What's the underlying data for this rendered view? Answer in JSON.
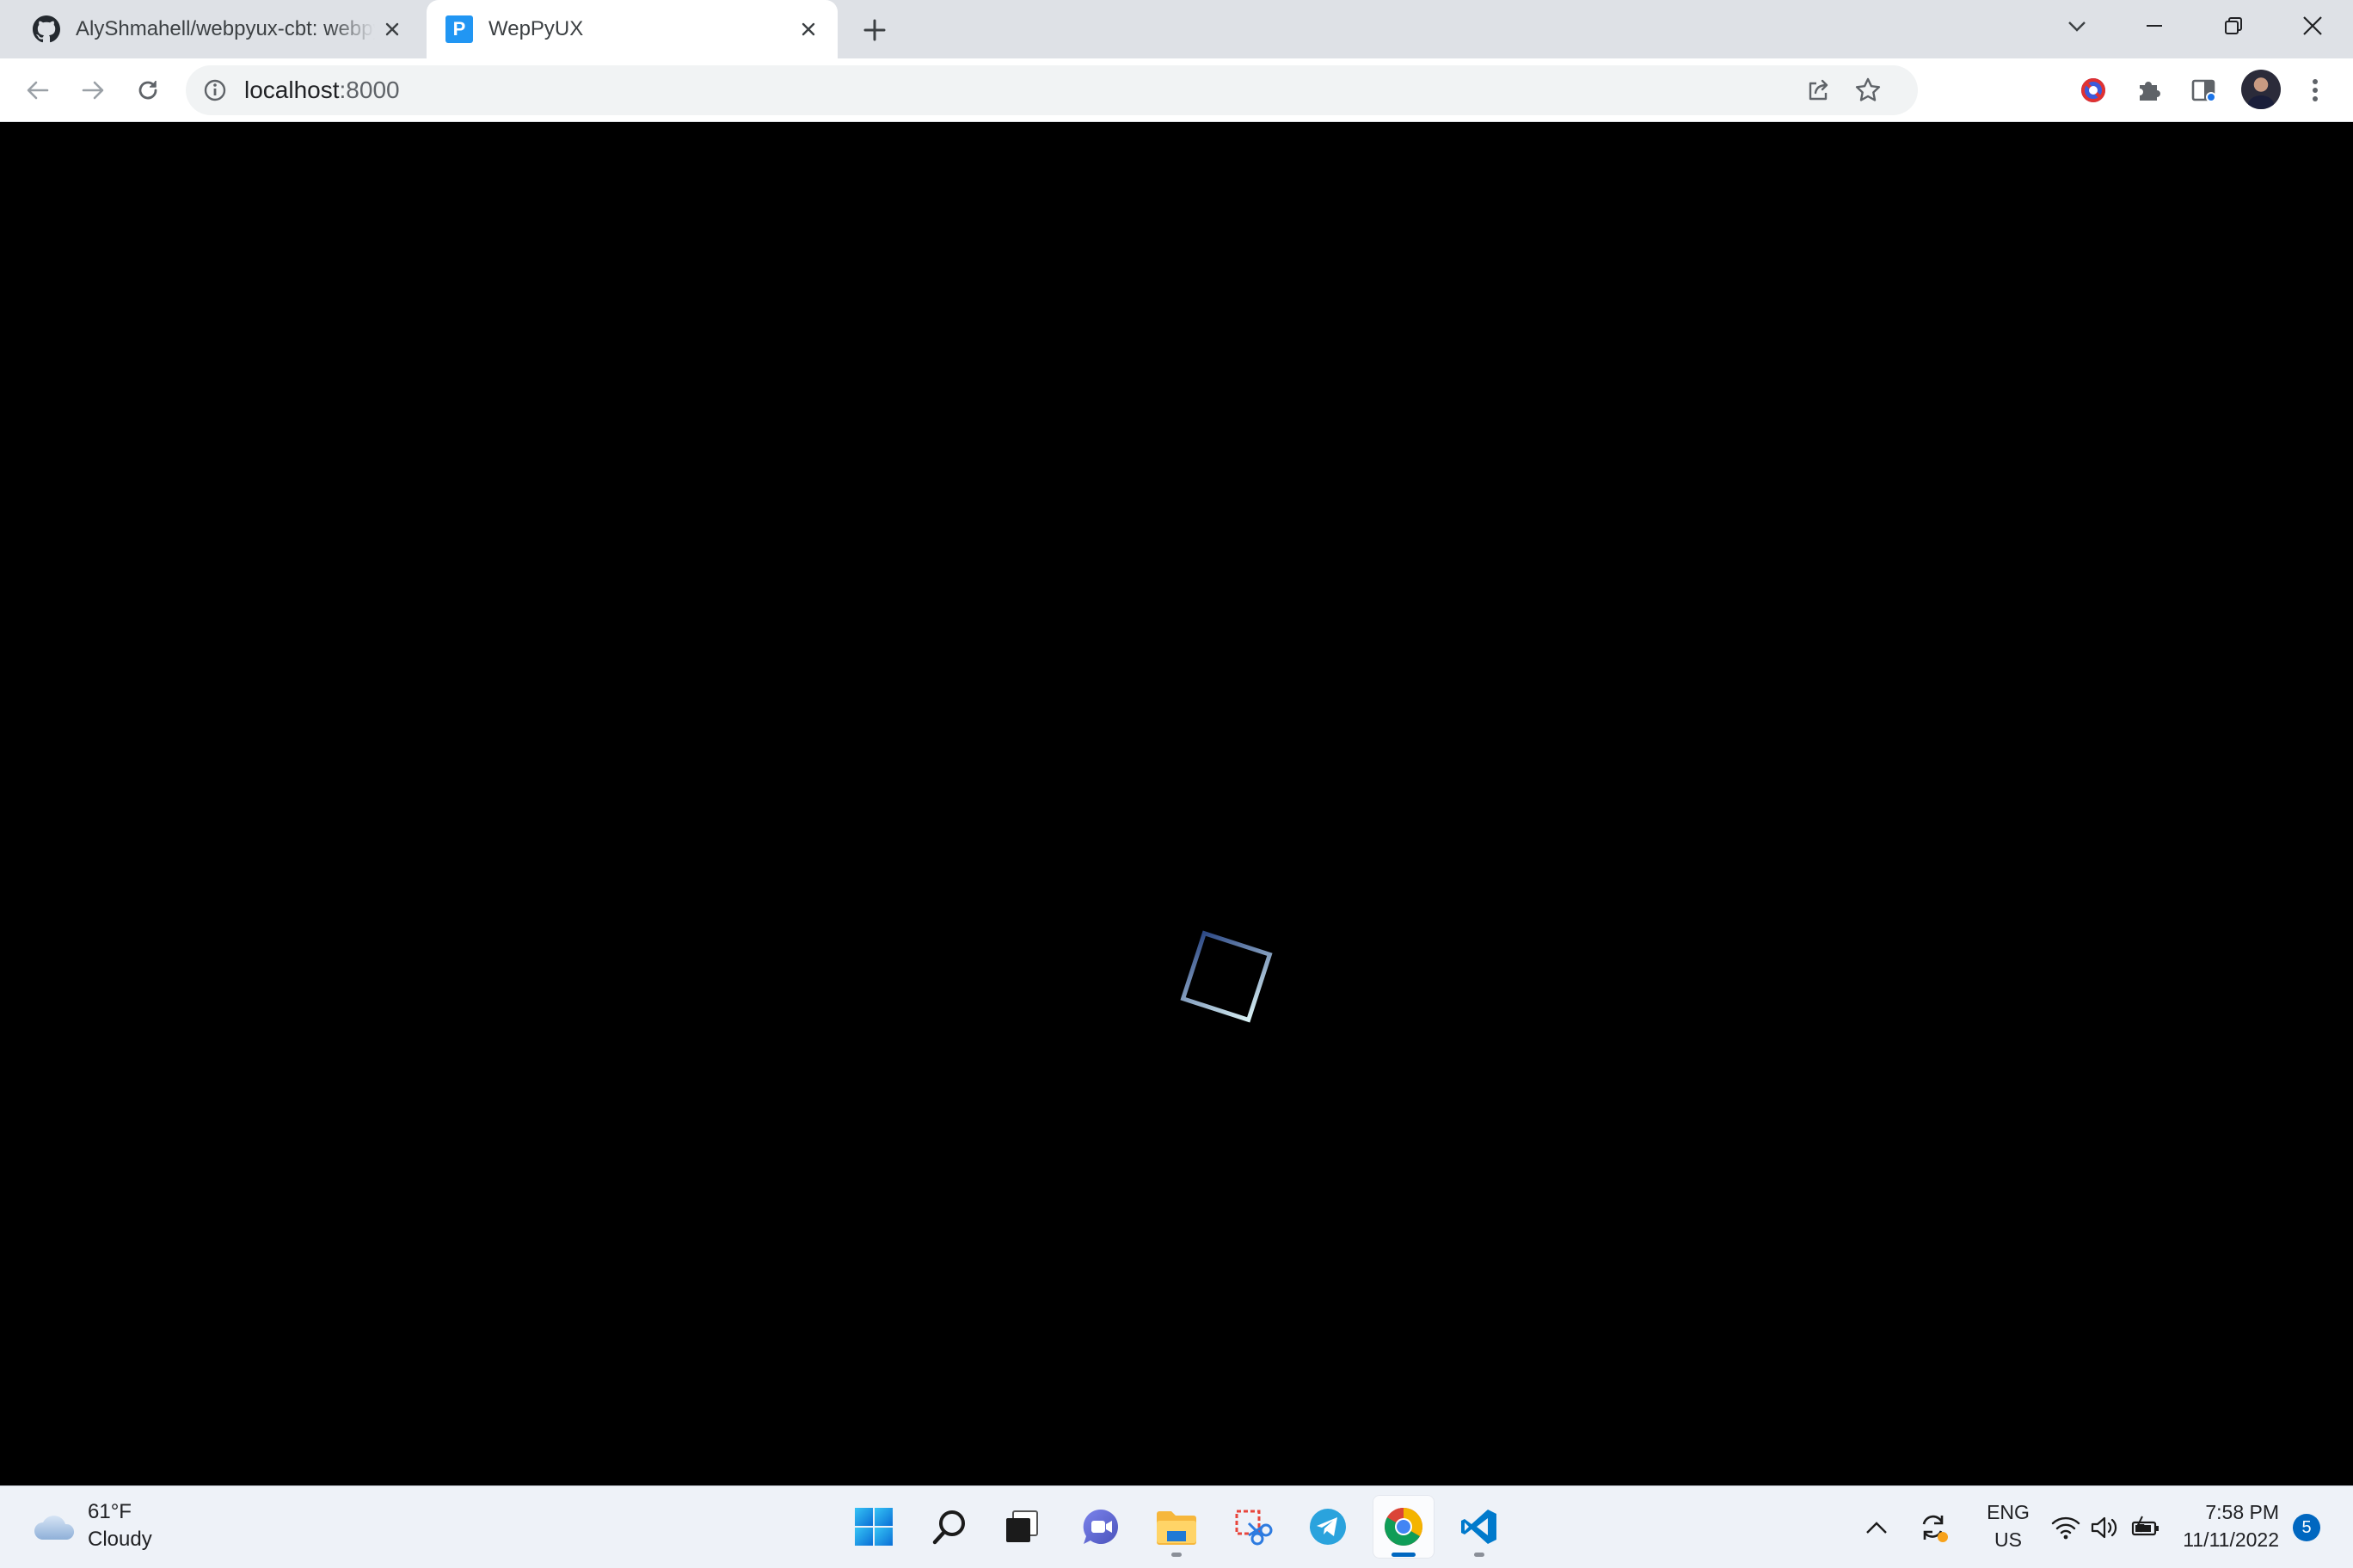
{
  "browser": {
    "tabs": [
      {
        "title": "AlyShmahell/webpyux-cbt: webpyux",
        "favicon": "github-icon",
        "active": false
      },
      {
        "title": "WepPyUX",
        "favicon": "P",
        "active": true
      }
    ],
    "url_host": "localhost",
    "url_port": ":8000",
    "accent": "#1a73e8"
  },
  "page": {
    "background": "#000000",
    "loader": {
      "gradient_start": "#2e4a86",
      "gradient_end": "#d8f0f4"
    }
  },
  "taskbar": {
    "weather": {
      "temp": "61°F",
      "condition": "Cloudy"
    },
    "apps": [
      "windows-start",
      "search",
      "task-view",
      "chat",
      "file-explorer",
      "snipping-tool",
      "telegram",
      "chrome",
      "vscode"
    ],
    "tray": {
      "lang_line1": "ENG",
      "lang_line2": "US",
      "time": "7:58 PM",
      "date": "11/11/2022",
      "notifications": "5"
    }
  }
}
